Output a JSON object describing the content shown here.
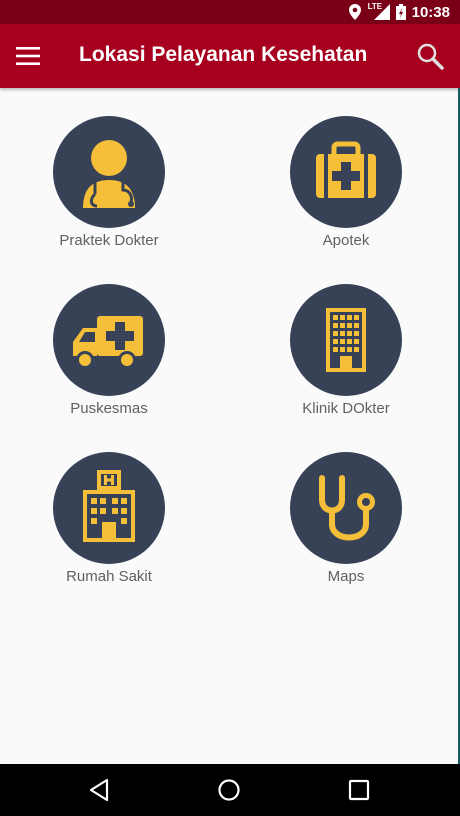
{
  "status_bar": {
    "time": "10:38",
    "network": "LTE",
    "icons": [
      "location-icon",
      "lte-signal-icon",
      "battery-icon"
    ]
  },
  "app_bar": {
    "title": "Lokasi Pelayanan Kesehatan",
    "menu_icon": "menu-icon",
    "search_icon": "search-icon"
  },
  "menu": {
    "items": [
      {
        "label": "Praktek Dokter",
        "icon": "doctor-icon"
      },
      {
        "label": "Apotek",
        "icon": "medical-kit-icon"
      },
      {
        "label": "Puskesmas",
        "icon": "ambulance-icon"
      },
      {
        "label": "Klinik DOkter",
        "icon": "clinic-building-icon"
      },
      {
        "label": "Rumah Sakit",
        "icon": "hospital-icon"
      },
      {
        "label": "Maps",
        "icon": "stethoscope-icon"
      }
    ]
  },
  "nav_bar": {
    "icons": [
      "back-icon",
      "home-icon",
      "recents-icon"
    ]
  },
  "colors": {
    "status_bar": "#7a0018",
    "app_bar": "#a6001e",
    "icon_circle": "#374257",
    "icon_accent": "#f5bf3a",
    "label_text": "#616161"
  }
}
